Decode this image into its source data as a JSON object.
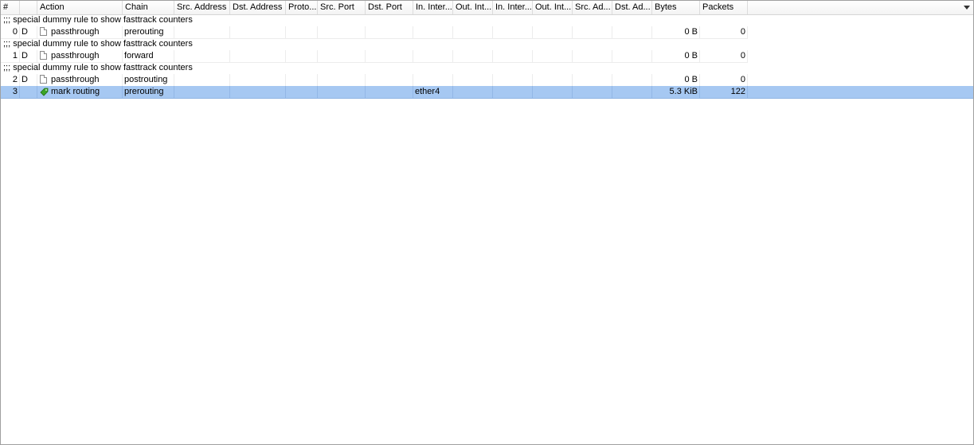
{
  "columns": [
    "#",
    "",
    "Action",
    "Chain",
    "Src. Address",
    "Dst. Address",
    "Proto...",
    "Src. Port",
    "Dst. Port",
    "In. Inter...",
    "Out. Int...",
    "In. Inter...",
    "Out. Int...",
    "Src. Ad...",
    "Dst. Ad...",
    "Bytes",
    "Packets"
  ],
  "rows": [
    {
      "comment": ";;; special dummy rule to show fasttrack counters",
      "num": "0",
      "flag": "D",
      "action": "passthrough",
      "action_icon": "document-icon",
      "chain": "prerouting",
      "in_interface": "",
      "bytes": "0 B",
      "packets": "0",
      "selected": false
    },
    {
      "comment": ";;; special dummy rule to show fasttrack counters",
      "num": "1",
      "flag": "D",
      "action": "passthrough",
      "action_icon": "document-icon",
      "chain": "forward",
      "in_interface": "",
      "bytes": "0 B",
      "packets": "0",
      "selected": false
    },
    {
      "comment": ";;; special dummy rule to show fasttrack counters",
      "num": "2",
      "flag": "D",
      "action": "passthrough",
      "action_icon": "document-icon",
      "chain": "postrouting",
      "in_interface": "",
      "bytes": "0 B",
      "packets": "0",
      "selected": false
    },
    {
      "comment": "",
      "num": "3",
      "flag": "",
      "action": "mark routing",
      "action_icon": "green-tag-icon",
      "chain": "prerouting",
      "in_interface": "ether4",
      "bytes": "5.3 KiB",
      "packets": "122",
      "selected": true
    }
  ],
  "colors": {
    "selection": "#a6c8f2",
    "tag_icon": "#3aa428"
  }
}
